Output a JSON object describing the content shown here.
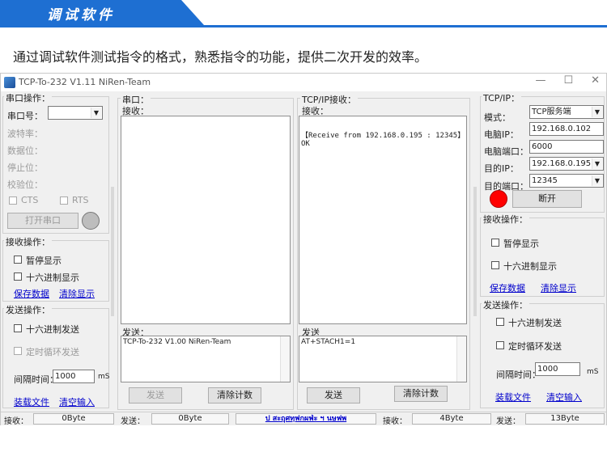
{
  "header": {
    "title": "调试软件",
    "intro": "通过调试软件测试指令的格式，熟悉指令的功能，提供二次开发的效率。"
  },
  "window": {
    "title": "TCP-To-232 V1.11    NiRen-Team",
    "minimize": "—",
    "maximize": "☐",
    "close": "✕"
  },
  "serial": {
    "title": "串口操作：",
    "port_label": "串口号：",
    "port_value": "",
    "baud_label": "波特率：",
    "data_label": "数据位：",
    "stop_label": "停止位：",
    "parity_label": "校验位：",
    "cts_label": "CTS",
    "rts_label": "RTS",
    "open_button": "打开串口"
  },
  "receive_ops": {
    "title": "接收操作：",
    "pause": "暂停显示",
    "hex": "十六进制显示",
    "save": "保存数据",
    "clear": "清除显示"
  },
  "send_ops": {
    "title": "发送操作：",
    "hex": "十六进制发送",
    "loop": "定时循环发送",
    "interval_label": "间隔时间：",
    "interval_value": "1000",
    "unit": "mS",
    "load": "装载文件",
    "clear_input": "清空输入"
  },
  "serial_panel": {
    "title": "串口：",
    "receive_label": "接收：",
    "send_label": "发送：",
    "send_value": "TCP-To-232 V1.00   NiRen-Team",
    "send_button": "发送",
    "clear_count": "清除计数"
  },
  "tcp_panel": {
    "title": "TCP/IP接收：",
    "receive_label": "接收：",
    "receive_value": "【Receive from 192.168.0.195 : 12345】\nOK",
    "send_label": "发送",
    "send_value": "AT+STACH1=1",
    "send_button": "发送",
    "clear_count": "清除计数"
  },
  "tcp_settings": {
    "title": "TCP/IP：",
    "mode_label": "模式：",
    "mode_value": "TCP服务端",
    "ip_label": "电脑IP：",
    "ip_value": "192.168.0.102",
    "port_label": "电脑端口：",
    "port_value": "6000",
    "dest_ip_label": "目的IP：",
    "dest_ip_value": "192.168.0.195",
    "dest_port_label": "目的端口：",
    "dest_port_value": "12345",
    "disconnect_button": "断开",
    "status_color": "#ff0000"
  },
  "tcp_receive_ops": {
    "title": "接收操作：",
    "pause": "暂停显示",
    "hex": "十六进制显示",
    "save": "保存数据",
    "clear": "清除显示"
  },
  "tcp_send_ops": {
    "title": "发送操作：",
    "hex": "十六进制发送",
    "loop": "定时循环发送",
    "interval_label": "间隔时间：",
    "interval_value": "1000",
    "unit": "mS",
    "load": "装载文件",
    "clear_input": "清空输入"
  },
  "statusbar": {
    "recv_label": "接收：",
    "recv_value": "0Byte",
    "send_label": "发送：",
    "send_value": "0Byte",
    "center_link": "ป สะฤุศทฺฟกผฟ่ะ ฯ นษฟพ",
    "tcp_recv_label": "接收：",
    "tcp_recv_value": "4Byte",
    "tcp_send_label": "发送：",
    "tcp_send_value": "13Byte"
  }
}
